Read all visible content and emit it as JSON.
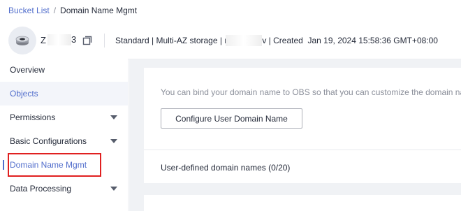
{
  "breadcrumb": {
    "parent": "Bucket List",
    "separator": "/",
    "current": "Domain Name Mgmt"
  },
  "bucket": {
    "name_visible_start": "Z",
    "name_visible_end": "3",
    "storage_class": "Standard",
    "redundancy": "Multi-AZ storage",
    "region_visible_start": "r",
    "region_visible_end": "v",
    "created_label": "Created",
    "created_value": "Jan 19, 2024 15:58:36 GMT+08:00"
  },
  "sidebar": {
    "items": [
      {
        "label": "Overview"
      },
      {
        "label": "Objects"
      },
      {
        "label": "Permissions"
      },
      {
        "label": "Basic Configurations"
      },
      {
        "label": "Domain Name Mgmt"
      },
      {
        "label": "Data Processing"
      }
    ]
  },
  "main": {
    "description": "You can bind your domain name to OBS so that you can customize the domain na",
    "configure_button": "Configure User Domain Name",
    "section_title": "User-defined domain names (0/20)"
  },
  "colors": {
    "accent": "#526ecc",
    "highlight_box": "#e02020",
    "content_bg": "#f0f2f5"
  }
}
